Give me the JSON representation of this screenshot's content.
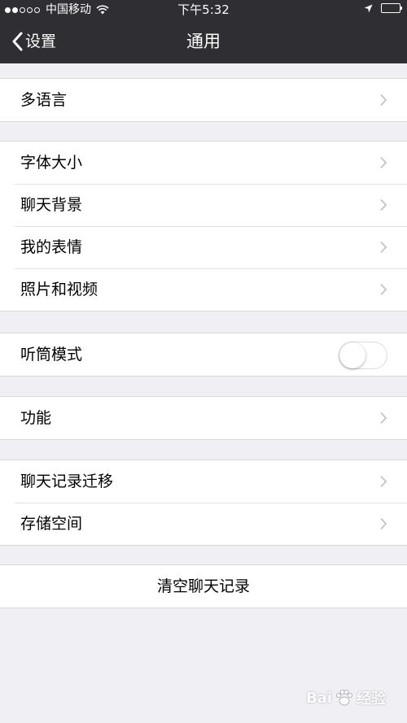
{
  "status_bar": {
    "carrier": "中国移动",
    "time": "下午5:32"
  },
  "nav": {
    "back_label": "设置",
    "title": "通用"
  },
  "groups": [
    [
      {
        "label": "多语言"
      }
    ],
    [
      {
        "label": "字体大小"
      },
      {
        "label": "聊天背景"
      },
      {
        "label": "我的表情"
      },
      {
        "label": "照片和视频"
      }
    ],
    [
      {
        "label": "听筒模式",
        "toggle": false
      }
    ],
    [
      {
        "label": "功能"
      }
    ],
    [
      {
        "label": "聊天记录迁移"
      },
      {
        "label": "存储空间"
      }
    ],
    [
      {
        "label": "清空聊天记录"
      }
    ]
  ],
  "watermark": {
    "left": "Bai",
    "right": "经验"
  },
  "colors": {
    "nav_background": "#2e2e33",
    "page_background": "#efeff4",
    "cell_background": "#ffffff",
    "chevron": "#c7c7cc"
  }
}
